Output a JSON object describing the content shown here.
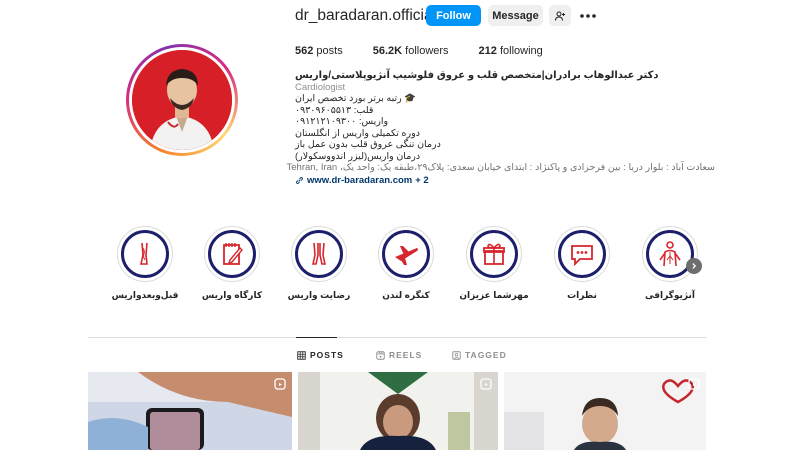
{
  "profile": {
    "username": "dr_baradaran.official",
    "follow_label": "Follow",
    "message_label": "Message"
  },
  "stats": {
    "posts_count": "562",
    "posts_label": "posts",
    "followers_count": "56.2K",
    "followers_label": "followers",
    "following_count": "212",
    "following_label": "following"
  },
  "bio": {
    "name": "دکتر عبدالوهاب برادران|متخصص قلب و عروق فلوشیپ آنژیوپلاستی/واریس",
    "category": "Cardiologist",
    "lines": [
      "🎓 رتبه برتر بورد تخصص ایران",
      "قلب: ۰۹۳۰۹۶۰۵۵۱۳",
      "واریس: ۰۹۱۲۱۲۱۰۹۳۰۰",
      "دوره تکمیلی واریس از انگلستان",
      "درمان تنگی عروق قلب بدون عمل باز",
      "درمان واریس(لیزر اندووسکولار)"
    ],
    "address": "سعادت آباد : بلوار دریا : بین فرحزادی و پاکنژاد : ابتدای خیابان سعدی: پلاک۲۹،طبقه یک: واحد یک، Tehran, Iran",
    "link": "www.dr-baradaran.com",
    "link_more": "+ 2"
  },
  "highlights": [
    {
      "label": "آنژیوگرافی",
      "icon": "body-vessels-icon"
    },
    {
      "label": "نظرات",
      "icon": "chat-bubble-icon"
    },
    {
      "label": "مهرشما عزیزان",
      "icon": "gift-icon"
    },
    {
      "label": "کنگره لندن",
      "icon": "airplane-icon"
    },
    {
      "label": "رضایت واریس",
      "icon": "legs-icon"
    },
    {
      "label": "کارگاه واریس",
      "icon": "notepad-icon"
    },
    {
      "label": "قبل‌وبعدواریس",
      "icon": "leg-icon"
    }
  ],
  "tabs": [
    {
      "label": "POSTS",
      "icon": "grid-icon",
      "active": true
    },
    {
      "label": "REELS",
      "icon": "reels-icon",
      "active": false
    },
    {
      "label": "TAGGED",
      "icon": "tag-icon",
      "active": false
    }
  ],
  "colors": {
    "follow_blue": "#0095f6",
    "highlight_ring": "#1d1f6b",
    "highlight_icon_red": "#d6262e"
  }
}
